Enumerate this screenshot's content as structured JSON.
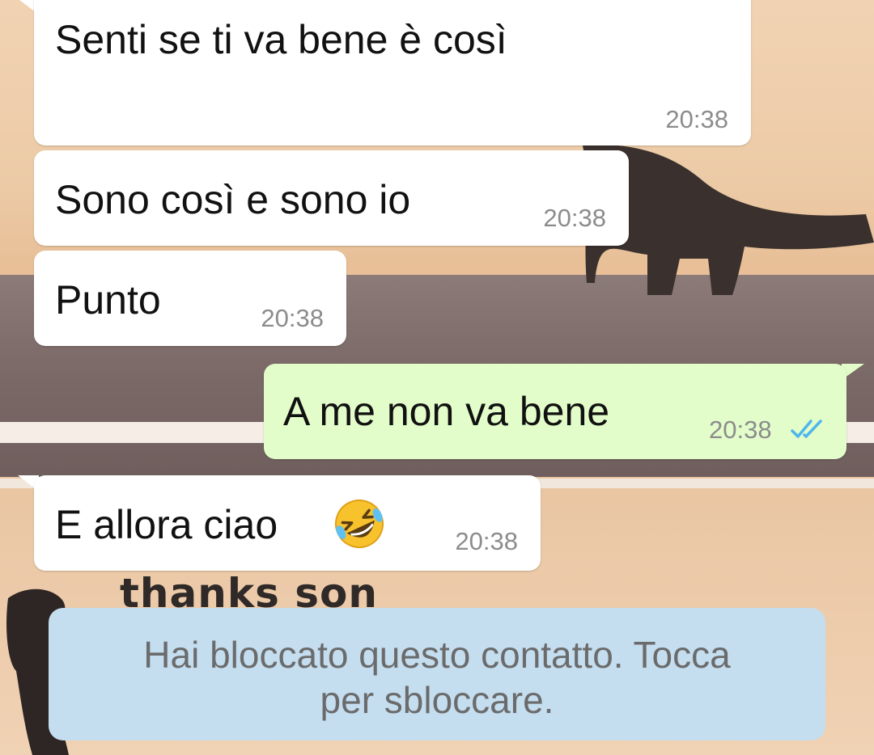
{
  "messages": [
    {
      "direction": "incoming",
      "text": "Senti se ti va bene è così",
      "time": "20:38"
    },
    {
      "direction": "incoming",
      "text": "Sono così e sono io",
      "time": "20:38"
    },
    {
      "direction": "incoming",
      "text": "Punto",
      "time": "20:38"
    },
    {
      "direction": "outgoing",
      "text": "A me non va bene",
      "time": "20:38",
      "status_icon": "double-check-read-icon"
    },
    {
      "direction": "incoming",
      "text": "E allora ciao",
      "emoji_icon": "rolling-on-floor-laughing-emoji",
      "time": "20:38"
    }
  ],
  "wallpaper": {
    "caption": "thanks son"
  },
  "blocked_banner": {
    "line1": "Hai bloccato questo contatto. Tocca",
    "line2": "per sbloccare."
  },
  "colors": {
    "incoming_bubble": "#ffffff",
    "outgoing_bubble": "#e2fdca",
    "banner": "#c4def0",
    "read_ticks": "#4fb6ec",
    "timestamp": "#8c8c8c"
  }
}
